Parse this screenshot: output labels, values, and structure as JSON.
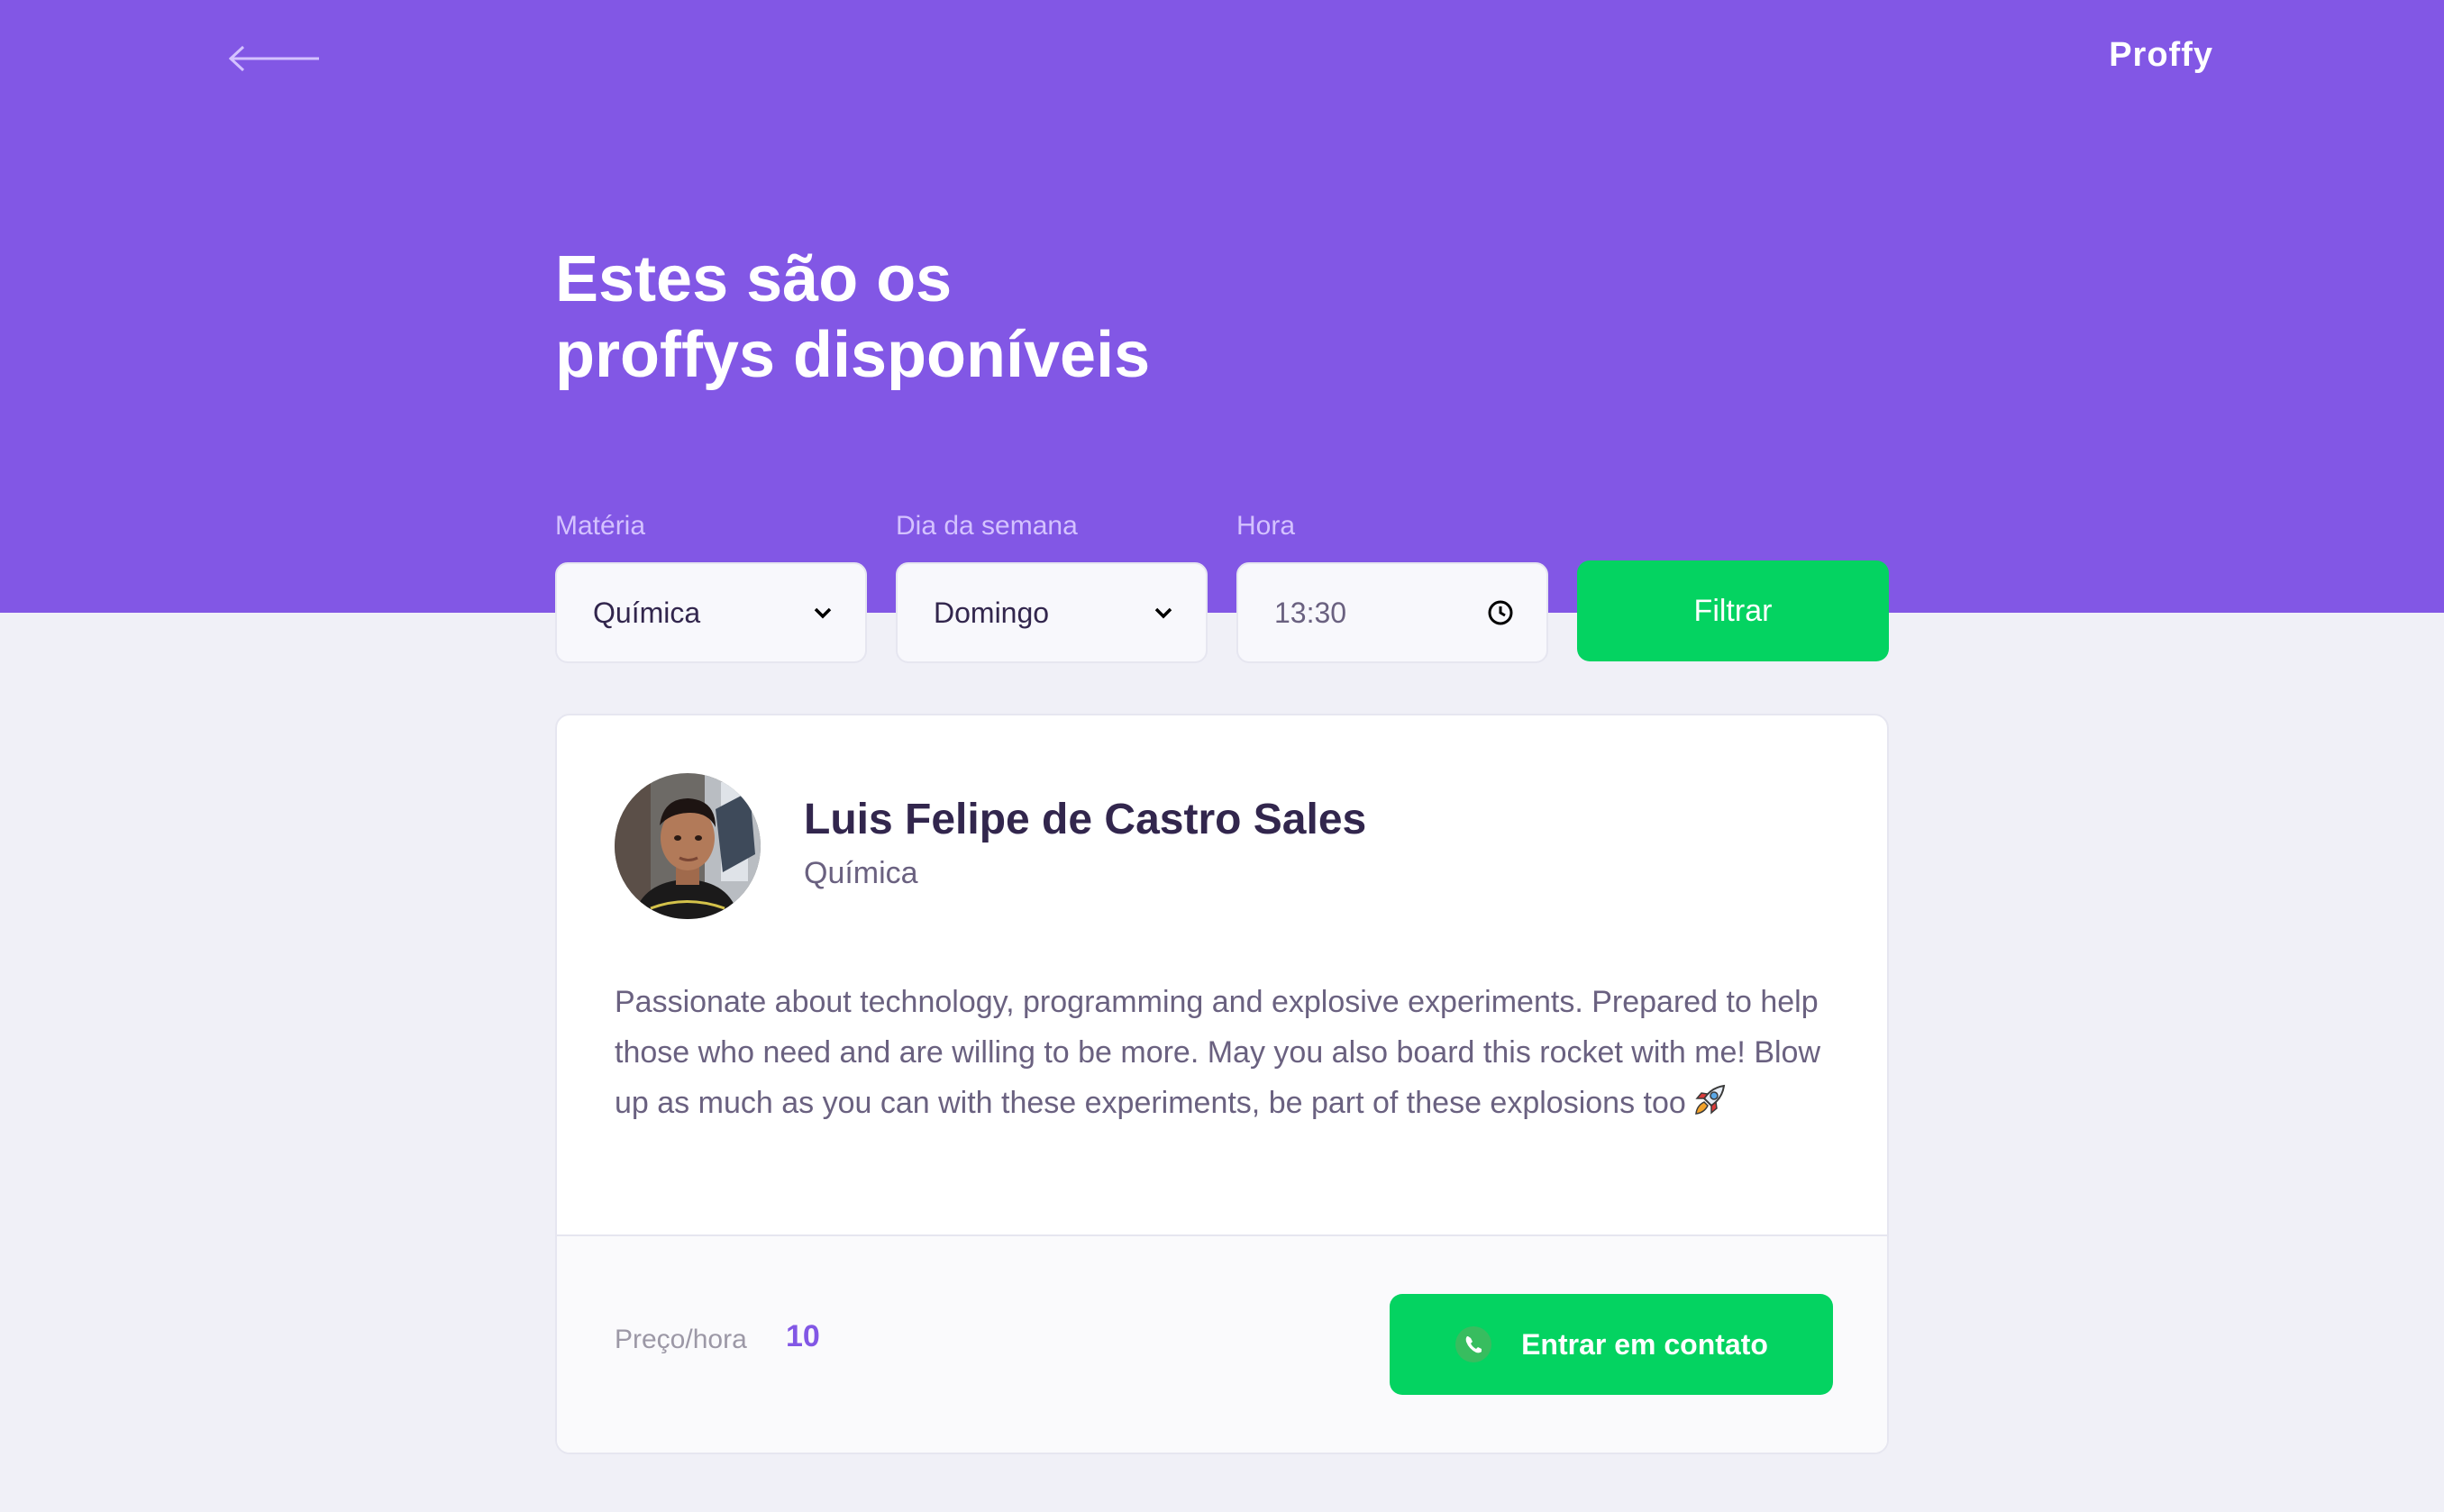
{
  "header": {
    "logo": "Proffy",
    "title_line1": "Estes são os",
    "title_line2": "proffys disponíveis",
    "back_icon": "arrow-left-icon"
  },
  "filters": {
    "subject": {
      "label": "Matéria",
      "value": "Química"
    },
    "weekday": {
      "label": "Dia da semana",
      "value": "Domingo"
    },
    "time": {
      "label": "Hora",
      "value": "13:30"
    },
    "submit_label": "Filtrar"
  },
  "teacher": {
    "name": "Luis Felipe de Castro Sales",
    "subject": "Química",
    "bio": "Passionate about technology, programming and explosive experiments. Prepared to help those who need and are willing to be more. May you also board this rocket with me! Blow up as much as you can with these experiments, be part of these explosions too",
    "price_label": "Preço/hora",
    "price_value": "10",
    "contact_label": "Entrar em contato"
  },
  "colors": {
    "primary": "#8257e5",
    "secondary": "#04d361",
    "background": "#f0f0f7",
    "title_text": "#32264d",
    "body_text": "#6a6180"
  }
}
